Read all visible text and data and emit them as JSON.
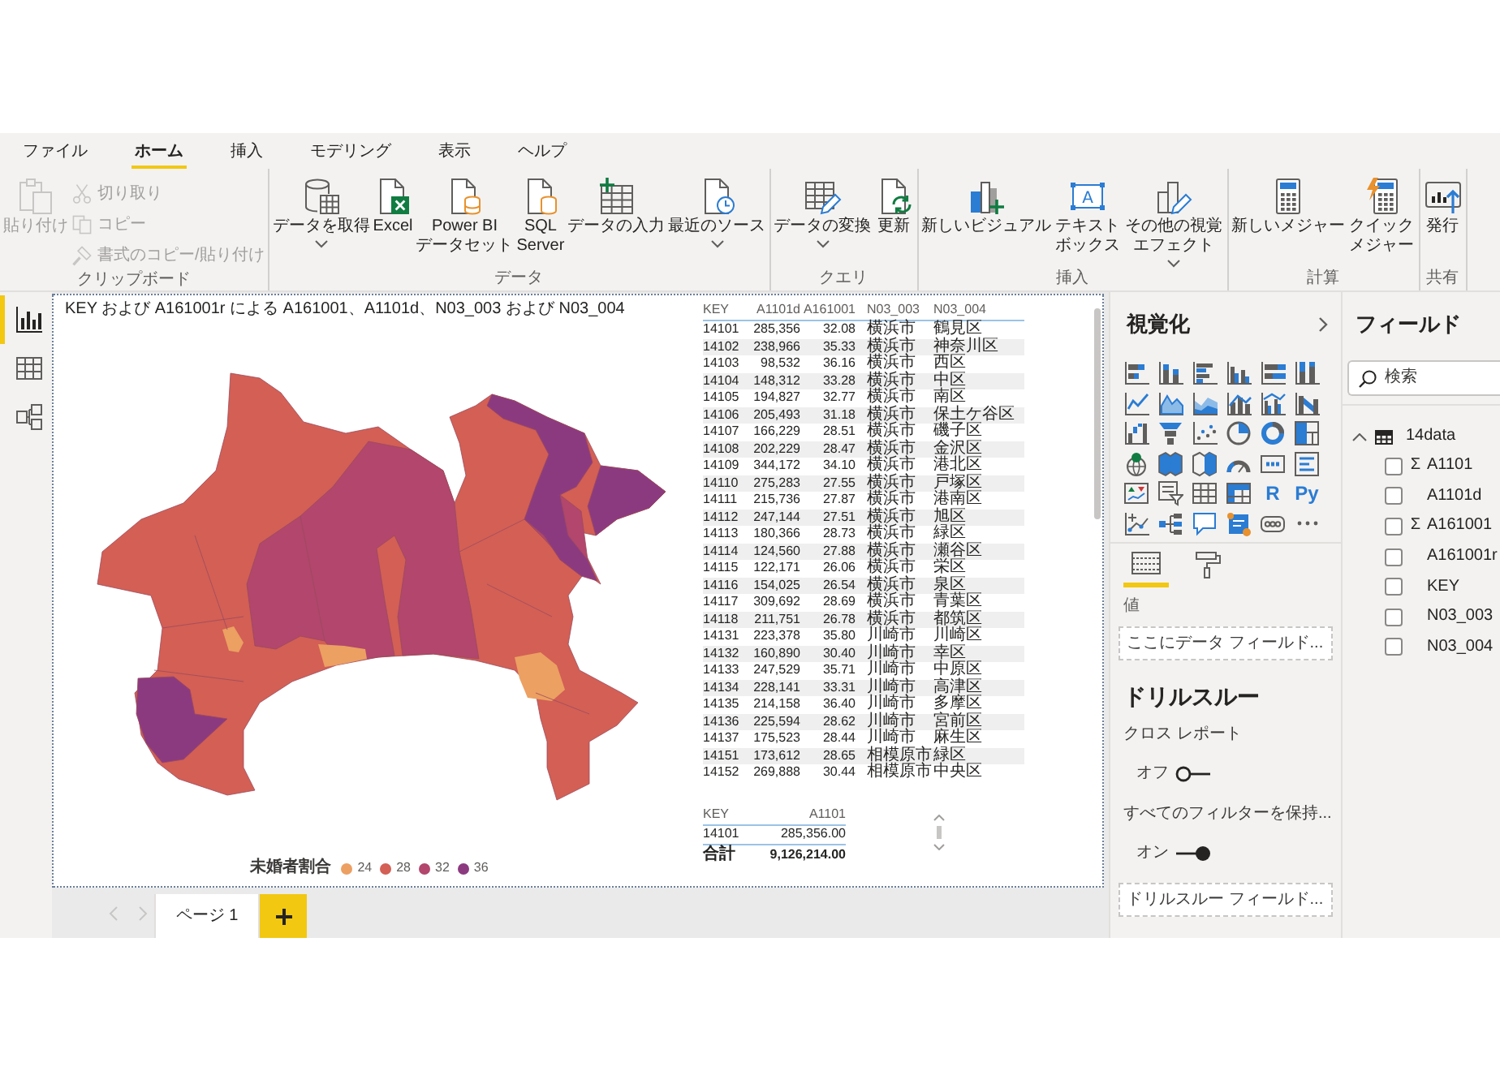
{
  "menu_tabs": [
    {
      "label": "ファイル",
      "selected": false
    },
    {
      "label": "ホーム",
      "selected": true
    },
    {
      "label": "挿入",
      "selected": false
    },
    {
      "label": "モデリング",
      "selected": false
    },
    {
      "label": "表示",
      "selected": false
    },
    {
      "label": "ヘルプ",
      "selected": false
    }
  ],
  "ribbon_groups": [
    {
      "label": "クリップボード",
      "buttons": [
        {
          "kind": "paste",
          "label": "貼り付け",
          "disabled": true,
          "dropdown": false
        },
        {
          "kind": "cut",
          "label": "切り取り",
          "disabled": true
        },
        {
          "kind": "copy",
          "label": "コピー",
          "disabled": true
        },
        {
          "kind": "formatpainter",
          "label": "書式のコピー/貼り付け",
          "disabled": true
        }
      ]
    },
    {
      "label": "データ",
      "buttons": [
        {
          "kind": "getdata",
          "label": "データを取得",
          "disabled": false,
          "dropdown": true
        },
        {
          "kind": "excel",
          "label": "Excel",
          "disabled": false,
          "dropdown": false
        },
        {
          "kind": "dataset",
          "label": "Power BI\nデータセット",
          "disabled": false,
          "dropdown": false
        },
        {
          "kind": "sql",
          "label": "SQL\nServer",
          "disabled": false,
          "dropdown": false
        },
        {
          "kind": "enterdata",
          "label": "データの入力",
          "disabled": false,
          "dropdown": false
        },
        {
          "kind": "recent",
          "label": "最近のソース",
          "disabled": false,
          "dropdown": true
        }
      ]
    },
    {
      "label": "クエリ",
      "buttons": [
        {
          "kind": "transform",
          "label": "データの変換",
          "disabled": false,
          "dropdown": true
        },
        {
          "kind": "refresh",
          "label": "更新",
          "disabled": false,
          "dropdown": false
        }
      ]
    },
    {
      "label": "挿入",
      "buttons": [
        {
          "kind": "newvisual",
          "label": "新しいビジュアル",
          "disabled": false,
          "dropdown": false
        },
        {
          "kind": "textbox",
          "label": "テキストボックス",
          "glyph": "A",
          "disabled": false,
          "dropdown": false
        },
        {
          "kind": "morevisuals",
          "label": "その他の視覚エフェクト",
          "disabled": false,
          "dropdown": true
        }
      ]
    },
    {
      "label": "計算",
      "buttons": [
        {
          "kind": "newmeasure",
          "label": "新しいメジャー",
          "disabled": false,
          "dropdown": false
        },
        {
          "kind": "quickmeasure",
          "label": "クイックメジャー",
          "disabled": false,
          "dropdown": false
        }
      ]
    },
    {
      "label": "共有",
      "buttons": [
        {
          "kind": "publish",
          "label": "発行",
          "disabled": false,
          "dropdown": false
        }
      ]
    }
  ],
  "view_switcher": [
    {
      "kind": "report",
      "selected": true
    },
    {
      "kind": "data",
      "selected": false
    },
    {
      "kind": "model",
      "selected": false
    }
  ],
  "report_canvas": {
    "map_visual": {
      "title": "KEY および A161001r による A161001、A1101d、N03_003 および N03_004",
      "legend": {
        "title": "未婚者割合",
        "items": [
          {
            "label": "24",
            "color": "#eca062"
          },
          {
            "label": "28",
            "color": "#d35f55"
          },
          {
            "label": "32",
            "color": "#b2466d"
          },
          {
            "label": "36",
            "color": "#8c3a80"
          }
        ]
      }
    },
    "table_visual": {
      "columns": [
        "KEY",
        "A1101d",
        "A161001",
        "N03_003",
        "N03_004"
      ],
      "rows": [
        [
          "14101",
          "285,356",
          "32.08",
          "横浜市",
          "鶴見区"
        ],
        [
          "14102",
          "238,966",
          "35.33",
          "横浜市",
          "神奈川区"
        ],
        [
          "14103",
          "98,532",
          "36.16",
          "横浜市",
          "西区"
        ],
        [
          "14104",
          "148,312",
          "33.28",
          "横浜市",
          "中区"
        ],
        [
          "14105",
          "194,827",
          "32.77",
          "横浜市",
          "南区"
        ],
        [
          "14106",
          "205,493",
          "31.18",
          "横浜市",
          "保土ケ谷区"
        ],
        [
          "14107",
          "166,229",
          "28.51",
          "横浜市",
          "磯子区"
        ],
        [
          "14108",
          "202,229",
          "28.47",
          "横浜市",
          "金沢区"
        ],
        [
          "14109",
          "344,172",
          "34.10",
          "横浜市",
          "港北区"
        ],
        [
          "14110",
          "275,283",
          "27.55",
          "横浜市",
          "戸塚区"
        ],
        [
          "14111",
          "215,736",
          "27.87",
          "横浜市",
          "港南区"
        ],
        [
          "14112",
          "247,144",
          "27.51",
          "横浜市",
          "旭区"
        ],
        [
          "14113",
          "180,366",
          "28.73",
          "横浜市",
          "緑区"
        ],
        [
          "14114",
          "124,560",
          "27.88",
          "横浜市",
          "瀬谷区"
        ],
        [
          "14115",
          "122,171",
          "26.06",
          "横浜市",
          "栄区"
        ],
        [
          "14116",
          "154,025",
          "26.54",
          "横浜市",
          "泉区"
        ],
        [
          "14117",
          "309,692",
          "28.69",
          "横浜市",
          "青葉区"
        ],
        [
          "14118",
          "211,751",
          "26.78",
          "横浜市",
          "都筑区"
        ],
        [
          "14131",
          "223,378",
          "35.80",
          "川崎市",
          "川崎区"
        ],
        [
          "14132",
          "160,890",
          "30.40",
          "川崎市",
          "幸区"
        ],
        [
          "14133",
          "247,529",
          "35.71",
          "川崎市",
          "中原区"
        ],
        [
          "14134",
          "228,141",
          "33.31",
          "川崎市",
          "高津区"
        ],
        [
          "14135",
          "214,158",
          "36.40",
          "川崎市",
          "多摩区"
        ],
        [
          "14136",
          "225,594",
          "28.62",
          "川崎市",
          "宮前区"
        ],
        [
          "14137",
          "175,523",
          "28.44",
          "川崎市",
          "麻生区"
        ],
        [
          "14151",
          "173,612",
          "28.65",
          "相模原市",
          "緑区"
        ],
        [
          "14152",
          "269,888",
          "30.44",
          "相模原市",
          "中央区"
        ]
      ]
    },
    "summary_table": {
      "columns": [
        "KEY",
        "A1101"
      ],
      "rows": [
        [
          "14101",
          "285,356.00"
        ]
      ],
      "total": [
        "合計",
        "9,126,214.00"
      ]
    }
  },
  "page_tabs": [
    {
      "label": "ページ 1",
      "selected": true
    }
  ],
  "visualizations_pane": {
    "title": "視覚化",
    "gallery": [
      {
        "kind": "stackedbar"
      },
      {
        "kind": "stackedcolumn"
      },
      {
        "kind": "clusteredbar"
      },
      {
        "kind": "clusteredcolumn"
      },
      {
        "kind": "percentbar"
      },
      {
        "kind": "percentcolumn"
      },
      {
        "kind": "line"
      },
      {
        "kind": "area"
      },
      {
        "kind": "stackedarea"
      },
      {
        "kind": "linecolumn"
      },
      {
        "kind": "lineclustered"
      },
      {
        "kind": "ribbon"
      },
      {
        "kind": "waterfall"
      },
      {
        "kind": "funnel"
      },
      {
        "kind": "scatter"
      },
      {
        "kind": "pie"
      },
      {
        "kind": "donut"
      },
      {
        "kind": "treemap"
      },
      {
        "kind": "map"
      },
      {
        "kind": "filledmap"
      },
      {
        "kind": "shapemap"
      },
      {
        "kind": "gauge"
      },
      {
        "kind": "card"
      },
      {
        "kind": "multirowcard"
      },
      {
        "kind": "kpi"
      },
      {
        "kind": "slicer"
      },
      {
        "kind": "table"
      },
      {
        "kind": "matrix"
      },
      {
        "kind": "rscript",
        "text": "R"
      },
      {
        "kind": "python",
        "text": "Py"
      },
      {
        "kind": "influencers"
      },
      {
        "kind": "decomposition"
      },
      {
        "kind": "qna"
      },
      {
        "kind": "narrative"
      },
      {
        "kind": "paginated"
      },
      {
        "kind": "more"
      }
    ],
    "build_tabs": [
      {
        "kind": "fields",
        "selected": true
      },
      {
        "kind": "format",
        "selected": false
      }
    ],
    "values": {
      "label": "値",
      "placeholder": "ここにデータ フィールド..."
    },
    "drillthrough": {
      "title": "ドリルスルー",
      "settings": [
        {
          "label": "クロス レポート",
          "state_label": "オフ",
          "on": false
        },
        {
          "label": "すべてのフィルターを保持...",
          "state_label": "オン",
          "on": true
        }
      ],
      "well": {
        "placeholder": "ドリルスルー フィールド..."
      }
    }
  },
  "fields_pane": {
    "title": "フィールド",
    "search": {
      "placeholder": "検索"
    },
    "tables": [
      {
        "name": "14data",
        "expanded": true,
        "children": [
          {
            "name": "A1101",
            "symbol": "Σ",
            "checked": false
          },
          {
            "name": "A1101d",
            "checked": false
          },
          {
            "name": "A161001",
            "symbol": "Σ",
            "checked": false
          },
          {
            "name": "A161001r",
            "checked": false
          },
          {
            "name": "KEY",
            "checked": false
          },
          {
            "name": "N03_003",
            "checked": false
          },
          {
            "name": "N03_004",
            "checked": false
          }
        ]
      }
    ]
  }
}
